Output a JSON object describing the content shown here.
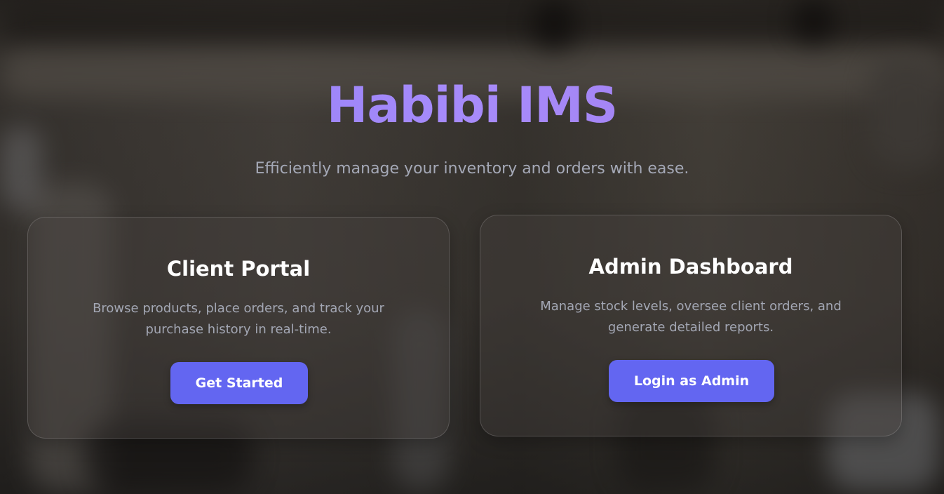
{
  "hero": {
    "title": "Habibi IMS",
    "subtitle": "Efficiently manage your inventory and orders with ease."
  },
  "cards": [
    {
      "title": "Client Portal",
      "description": "Browse products, place orders, and track your purchase history in real-time.",
      "button_label": "Get Started"
    },
    {
      "title": "Admin Dashboard",
      "description": "Manage stock levels, oversee client orders, and generate detailed reports.",
      "button_label": "Login as Admin"
    }
  ],
  "colors": {
    "accent": "#6366f1",
    "title_gradient_start": "#8b7cf6",
    "title_gradient_end": "#a78bfa",
    "text_muted": "#a3a7b4"
  }
}
